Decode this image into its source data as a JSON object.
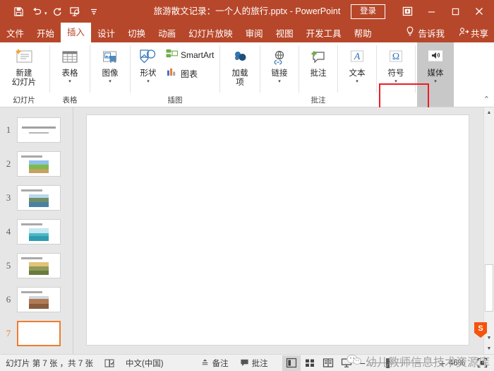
{
  "titlebar": {
    "document_title": "旅游散文记录：一个人的旅行.pptx  -  PowerPoint",
    "signin_label": "登录",
    "quick_access": [
      {
        "name": "save-icon",
        "label": "保存"
      },
      {
        "name": "undo-icon",
        "label": "撤消"
      },
      {
        "name": "redo-icon",
        "label": "重复"
      },
      {
        "name": "start-slideshow-icon",
        "label": "从头开始"
      },
      {
        "name": "customize-qat-icon",
        "label": "自定义快速访问工具栏"
      }
    ],
    "window_controls": [
      {
        "name": "ribbon-display-options-icon",
        "label": "功能区显示选项"
      },
      {
        "name": "minimize-icon",
        "label": "最小化"
      },
      {
        "name": "maximize-icon",
        "label": "最大化"
      },
      {
        "name": "close-icon",
        "label": "关闭"
      }
    ]
  },
  "tabs": [
    {
      "label": "文件",
      "active": false
    },
    {
      "label": "开始",
      "active": false
    },
    {
      "label": "插入",
      "active": true
    },
    {
      "label": "设计",
      "active": false
    },
    {
      "label": "切换",
      "active": false
    },
    {
      "label": "动画",
      "active": false
    },
    {
      "label": "幻灯片放映",
      "active": false
    },
    {
      "label": "审阅",
      "active": false
    },
    {
      "label": "视图",
      "active": false
    },
    {
      "label": "开发工具",
      "active": false
    },
    {
      "label": "帮助",
      "active": false
    }
  ],
  "tellme": {
    "label": "告诉我",
    "icon": "lightbulb-icon"
  },
  "share": {
    "label": "共享",
    "icon": "person-share-icon"
  },
  "ribbon": {
    "collapse_label": "折叠功能区",
    "groups": [
      {
        "name": "slides",
        "label": "幻灯片",
        "items": [
          {
            "name": "new-slide",
            "label": "新建",
            "label2": "幻灯片",
            "icon": "new-slide-icon",
            "has_caret": true
          }
        ]
      },
      {
        "name": "tables",
        "label": "表格",
        "items": [
          {
            "name": "table",
            "label": "表格",
            "icon": "table-icon",
            "has_caret": true
          }
        ]
      },
      {
        "name": "images",
        "label": "",
        "items": [
          {
            "name": "images",
            "label": "图像",
            "icon": "images-icon",
            "has_caret": true
          }
        ]
      },
      {
        "name": "illustrations",
        "label": "插图",
        "items": [
          {
            "name": "shapes",
            "label": "形状",
            "icon": "shapes-icon",
            "has_caret": true
          },
          {
            "name": "smartart",
            "label": "SmartArt",
            "icon": "smartart-icon"
          },
          {
            "name": "chart",
            "label": "图表",
            "icon": "chart-icon"
          }
        ]
      },
      {
        "name": "addins",
        "label": "",
        "items": [
          {
            "name": "addins",
            "label": "加载",
            "label2": "项",
            "icon": "addins-icon",
            "has_caret": true
          }
        ]
      },
      {
        "name": "links",
        "label": "",
        "items": [
          {
            "name": "link",
            "label": "链接",
            "icon": "link-icon",
            "has_caret": true
          }
        ]
      },
      {
        "name": "comments",
        "label": "批注",
        "items": [
          {
            "name": "comment",
            "label": "批注",
            "icon": "comment-icon"
          }
        ]
      },
      {
        "name": "text",
        "label": "",
        "items": [
          {
            "name": "text",
            "label": "文本",
            "icon": "text-A-icon",
            "has_caret": true
          }
        ]
      },
      {
        "name": "symbols",
        "label": "",
        "items": [
          {
            "name": "symbol",
            "label": "符号",
            "icon": "omega-icon",
            "has_caret": true
          }
        ]
      },
      {
        "name": "media",
        "label": "",
        "highlighted": true,
        "items": [
          {
            "name": "media",
            "label": "媒体",
            "icon": "speaker-icon",
            "has_caret": true
          }
        ]
      }
    ],
    "highlight_color": "#ee1c25"
  },
  "thumbnails": [
    {
      "number": "1",
      "selected": false,
      "kind": "title",
      "img": ""
    },
    {
      "number": "2",
      "selected": false,
      "kind": "content",
      "img": "field-road"
    },
    {
      "number": "3",
      "selected": false,
      "kind": "content",
      "img": "cliff-sea"
    },
    {
      "number": "4",
      "selected": false,
      "kind": "content",
      "img": "island-boat"
    },
    {
      "number": "5",
      "selected": false,
      "kind": "content",
      "img": "golden-field"
    },
    {
      "number": "6",
      "selected": false,
      "kind": "content",
      "img": "desert-canyon"
    },
    {
      "number": "7",
      "selected": true,
      "kind": "blank",
      "img": ""
    }
  ],
  "statusbar": {
    "slide_count_label": "幻灯片 第 7 张 ，共 7 张",
    "accessibility_icon": "accessibility-check-icon",
    "language": "中文(中国)",
    "notes_label": "备注",
    "notes_icon": "notes-icon",
    "comments_label": "批注",
    "comments_icon": "comment-bubble-icon",
    "views": [
      {
        "name": "normal-view",
        "label": "普通视图",
        "active": true
      },
      {
        "name": "slide-sorter-view",
        "label": "幻灯片浏览",
        "active": false
      },
      {
        "name": "reading-view",
        "label": "阅读视图",
        "active": false
      },
      {
        "name": "slideshow-view",
        "label": "幻灯片放映",
        "active": false
      }
    ],
    "zoom_out_label": "−",
    "zoom_in_label": "+",
    "zoom_percent": "46%",
    "fit_icon": "fit-to-window-icon"
  },
  "watermark": {
    "text": "幼儿教师信息技术资源库",
    "icon": "wechat-icon",
    "corner_badge": "sogou-badge"
  }
}
